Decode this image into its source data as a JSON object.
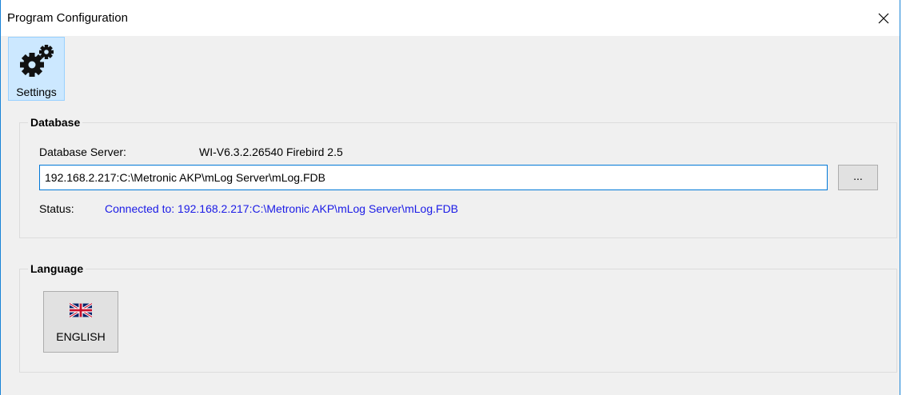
{
  "window": {
    "title": "Program Configuration",
    "close_glyph": "✕",
    "close_icon": "close-icon"
  },
  "toolbar": {
    "settings_label": "Settings",
    "settings_icon": "gears-icon"
  },
  "database": {
    "group_title": "Database",
    "server_label": "Database Server:",
    "server_value": "WI-V6.3.2.26540 Firebird 2.5",
    "path_value": "192.168.2.217:C:\\Metronic AKP\\mLog Server\\mLog.FDB",
    "browse_label": "...",
    "status_label": "Status:",
    "status_value": "Connected to: 192.168.2.217:C:\\Metronic AKP\\mLog Server\\mLog.FDB"
  },
  "language": {
    "group_title": "Language",
    "current_label": "ENGLISH",
    "flag_icon": "uk-flag-icon"
  },
  "colors": {
    "window_border": "#1883d7",
    "client_bg": "#f0f0f0",
    "selected_tool_bg": "#cce8ff",
    "status_link": "#1a1ae6",
    "input_focus_border": "#0078d7"
  }
}
